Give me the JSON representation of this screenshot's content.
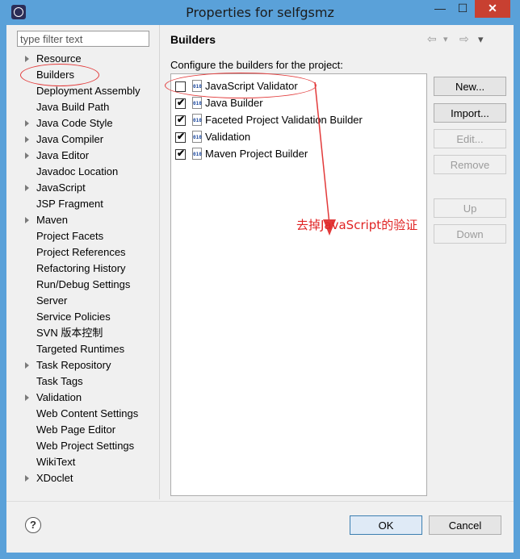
{
  "window": {
    "title": "Properties for selfgsmz",
    "minimize_glyph": "—",
    "maximize_glyph": "☐",
    "close_glyph": "✕"
  },
  "filter": {
    "placeholder": "type filter text"
  },
  "nav": {
    "items": [
      {
        "label": "Resource",
        "expandable": true
      },
      {
        "label": "Builders",
        "expandable": false
      },
      {
        "label": "Deployment Assembly",
        "expandable": false
      },
      {
        "label": "Java Build Path",
        "expandable": false
      },
      {
        "label": "Java Code Style",
        "expandable": true
      },
      {
        "label": "Java Compiler",
        "expandable": true
      },
      {
        "label": "Java Editor",
        "expandable": true
      },
      {
        "label": "Javadoc Location",
        "expandable": false
      },
      {
        "label": "JavaScript",
        "expandable": true
      },
      {
        "label": "JSP Fragment",
        "expandable": false
      },
      {
        "label": "Maven",
        "expandable": true
      },
      {
        "label": "Project Facets",
        "expandable": false
      },
      {
        "label": "Project References",
        "expandable": false
      },
      {
        "label": "Refactoring History",
        "expandable": false
      },
      {
        "label": "Run/Debug Settings",
        "expandable": false
      },
      {
        "label": "Server",
        "expandable": false
      },
      {
        "label": "Service Policies",
        "expandable": false
      },
      {
        "label": "SVN 版本控制",
        "expandable": false
      },
      {
        "label": "Targeted Runtimes",
        "expandable": false
      },
      {
        "label": "Task Repository",
        "expandable": true
      },
      {
        "label": "Task Tags",
        "expandable": false
      },
      {
        "label": "Validation",
        "expandable": true
      },
      {
        "label": "Web Content Settings",
        "expandable": false
      },
      {
        "label": "Web Page Editor",
        "expandable": false
      },
      {
        "label": "Web Project Settings",
        "expandable": false
      },
      {
        "label": "WikiText",
        "expandable": false
      },
      {
        "label": "XDoclet",
        "expandable": true
      }
    ]
  },
  "page": {
    "title": "Builders",
    "description": "Configure the builders for the project:",
    "nav_icons": {
      "back": "⇦",
      "forward": "⇨",
      "dropdown": "▾",
      "menu": "▾"
    },
    "builder_icon_text": "010",
    "builders": [
      {
        "label": "JavaScript Validator",
        "checked": false
      },
      {
        "label": "Java Builder",
        "checked": true
      },
      {
        "label": "Faceted Project Validation Builder",
        "checked": true
      },
      {
        "label": "Validation",
        "checked": true
      },
      {
        "label": "Maven Project Builder",
        "checked": true
      }
    ],
    "checkmark_glyph": "✔"
  },
  "side_buttons": {
    "new": "New...",
    "import": "Import...",
    "edit": "Edit...",
    "remove": "Remove",
    "up": "Up",
    "down": "Down"
  },
  "dialog_buttons": {
    "help": "?",
    "ok": "OK",
    "cancel": "Cancel"
  },
  "annotation": {
    "text": "去掉JavaScript的验证",
    "color": "#e02424"
  }
}
